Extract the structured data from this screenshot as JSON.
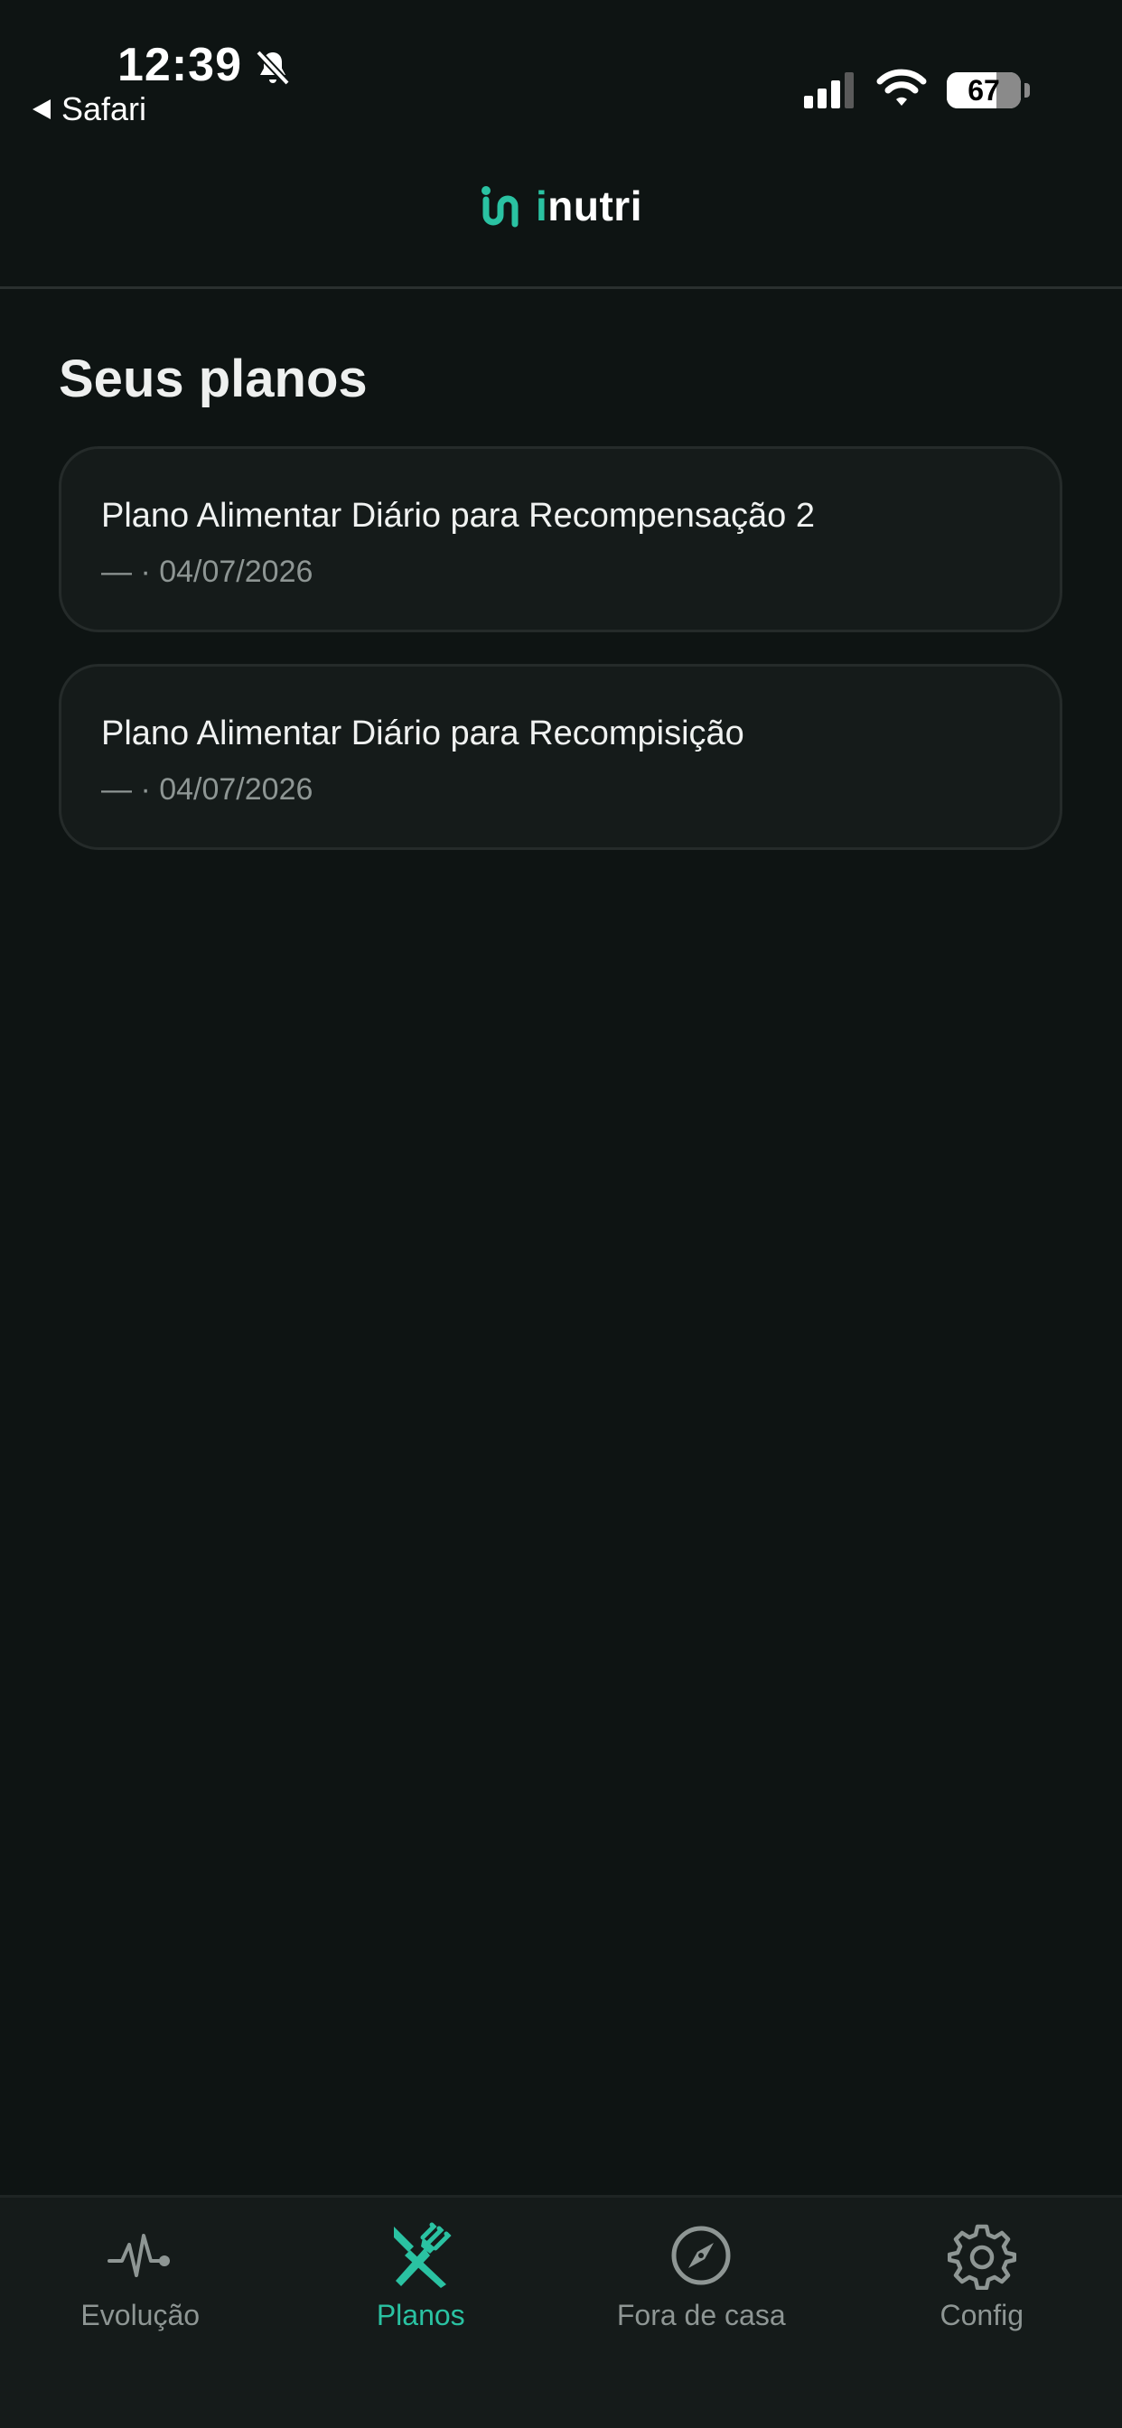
{
  "status_bar": {
    "time": "12:39",
    "back_app": "Safari",
    "battery": "67",
    "battery_level": 0.67
  },
  "header": {
    "logo_text_i": "i",
    "logo_text_rest": "nutri"
  },
  "main": {
    "title": "Seus planos",
    "plans": [
      {
        "title": "Plano Alimentar Diário para Recompensação 2",
        "meta": "— · 04/07/2026"
      },
      {
        "title": "Plano Alimentar Diário para Recompisição",
        "meta": "— · 04/07/2026"
      }
    ]
  },
  "tab_bar": {
    "tabs": [
      {
        "label": "Evolução",
        "icon": "heartbeat-icon",
        "active": false
      },
      {
        "label": "Planos",
        "icon": "fork-knife-icon",
        "active": true
      },
      {
        "label": "Fora de casa",
        "icon": "compass-icon",
        "active": false
      },
      {
        "label": "Config",
        "icon": "gear-icon",
        "active": false
      }
    ]
  },
  "colors": {
    "background": "#0e1413",
    "card": "#151b1a",
    "accent": "#2ac2a2",
    "muted_text": "#8e9694"
  }
}
